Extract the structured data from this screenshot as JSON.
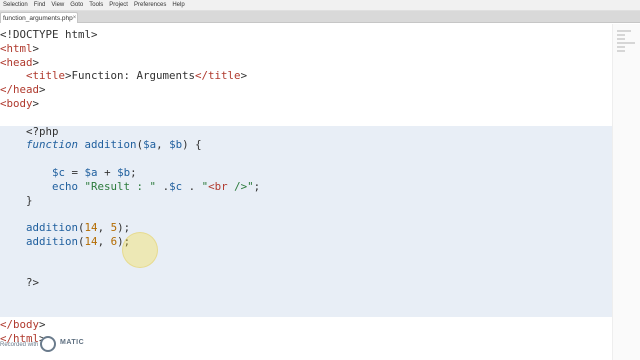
{
  "menu": {
    "items": [
      "Selection",
      "Find",
      "View",
      "Goto",
      "Tools",
      "Project",
      "Preferences",
      "Help"
    ]
  },
  "tabs": [
    {
      "label": "function_arguments.php",
      "close": "×"
    }
  ],
  "editor": {
    "lines": [
      {
        "t": "<!DOCTYPE html>"
      },
      {
        "t": "<html>"
      },
      {
        "t": "<head>"
      },
      {
        "t": "    <title>Function: Arguments</title>"
      },
      {
        "t": "</head>"
      },
      {
        "t": "<body>"
      },
      {
        "t": ""
      },
      {
        "t": "    <?php"
      },
      {
        "t": "    function addition($a, $b) {"
      },
      {
        "t": ""
      },
      {
        "t": "        $c = $a + $b;"
      },
      {
        "t": "        echo \"Result : \" .$c . \"<br />\";"
      },
      {
        "t": "    }"
      },
      {
        "t": ""
      },
      {
        "t": "    addition(14, 5);"
      },
      {
        "t": "    addition(14, 6);"
      },
      {
        "t": ""
      },
      {
        "t": ""
      },
      {
        "t": "    ?>"
      },
      {
        "t": ""
      },
      {
        "t": ""
      },
      {
        "t": "</body>"
      },
      {
        "t": "</html>"
      }
    ]
  },
  "watermark": {
    "brand": "MATIC",
    "prefix": "Recorded with"
  },
  "colors": {
    "php_block_bg": "#e8eef6",
    "keyword": "#1f5f9e",
    "string": "#2b7a3b",
    "number": "#b36b00",
    "tag": "#b03a2e",
    "cursor_highlight": "#f5dc3c"
  },
  "icons": {
    "tab_close": "close-icon",
    "watermark_logo": "screencast-logo-icon"
  }
}
